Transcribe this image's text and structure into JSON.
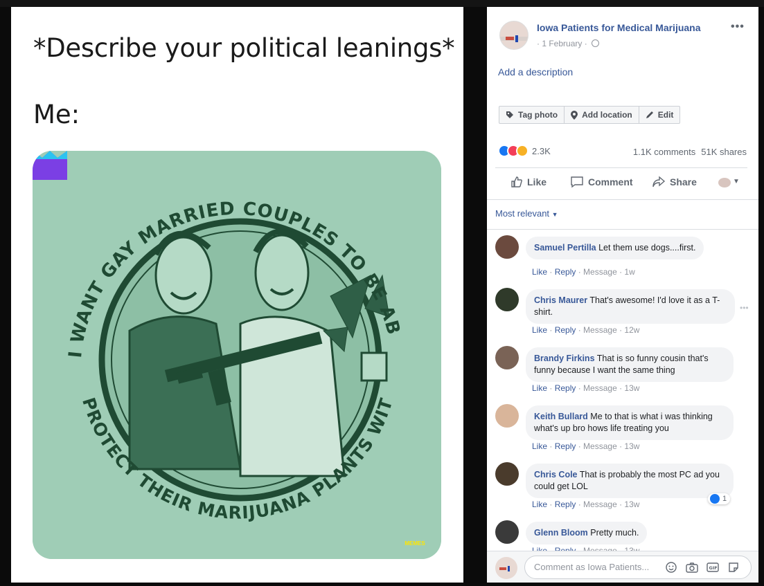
{
  "meme": {
    "caption": "*Describe your political leanings*",
    "me_label": "Me:",
    "shirt_text_top": "I WANT GAY MARRIED COUPLES TO BE ABLE TO",
    "shirt_text_bottom": "PROTECT THEIR MARIJUANA PLANTS WITH GUNS",
    "watermark": "MEMES"
  },
  "post": {
    "page_name": "Iowa Patients for Medical Marijuana",
    "date": "1 February",
    "add_description": "Add a description",
    "actions": [
      "Tag photo",
      "Add location",
      "Edit"
    ],
    "reaction_count": "2.3K",
    "comments_count": "1.1K comments",
    "shares_count": "51K shares",
    "like_label": "Like",
    "comment_label": "Comment",
    "share_label": "Share",
    "sort_label": "Most relevant"
  },
  "comments": [
    {
      "author": "Samuel Pertilla",
      "text": "Let them use dogs....first.",
      "time": "1w"
    },
    {
      "author": "Chris Maurer",
      "text": "That's awesome! I'd love it as a T-shirt.",
      "time": "12w"
    },
    {
      "author": "Brandy Firkins",
      "text": "That is so funny cousin that's funny because I want the same thing",
      "time": "13w"
    },
    {
      "author": "Keith Bullard",
      "text": "Me to that is what i was thinking what's up bro hows life treating you",
      "time": "13w"
    },
    {
      "author": "Chris Cole",
      "text": "That is probably the most PC ad you could get LOL",
      "time": "13w",
      "likes": "1"
    },
    {
      "author": "Glenn Bloom",
      "text": "Pretty much.",
      "time": "13w"
    }
  ],
  "comment_actions": {
    "like": "Like",
    "reply": "Reply",
    "message": "Message"
  },
  "compose": {
    "placeholder": "Comment as Iowa Patients..."
  },
  "colors": {
    "link": "#385898",
    "shirt": "#9fcdb6",
    "ink": "#1f4a33",
    "like_blue": "#1877f2"
  }
}
